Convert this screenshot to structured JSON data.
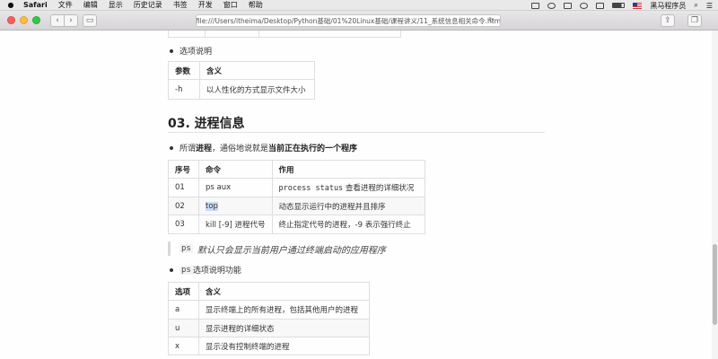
{
  "menubar": {
    "app": "Safari",
    "items": [
      "文件",
      "编辑",
      "显示",
      "历史记录",
      "书签",
      "开发",
      "窗口",
      "帮助"
    ],
    "user": "黑马程序员"
  },
  "toolbar": {
    "url": "file:///Users/itheima/Desktop/Python基础/01%20Linux基础/课程讲义/11_系统信息相关命令.htm"
  },
  "content": {
    "option_heading": "选项说明",
    "table1": {
      "headers": [
        "参数",
        "含义"
      ],
      "rows": [
        [
          "-h",
          "以人性化的方式显示文件大小"
        ]
      ]
    },
    "section_title": "03. 进程信息",
    "intro": {
      "prefix": "所谓 ",
      "term": "进程",
      "middle": "，通俗地说就是 ",
      "emph": "当前正在执行的一个程序"
    },
    "table2": {
      "headers": [
        "序号",
        "命令",
        "作用"
      ],
      "rows": [
        [
          "01",
          "ps aux",
          "process status",
          " 查看进程的详细状况"
        ],
        [
          "02",
          "top",
          "动态显示运行中的进程并且排序"
        ],
        [
          "03",
          "kill [-9] 进程代号",
          "终止指定代号的进程，-9 表示强行终止"
        ]
      ]
    },
    "quote": {
      "code": "ps",
      "text": "默认只会显示当前用户通过终端启动的应用程序"
    },
    "ps_options": {
      "code": "ps",
      "text": " 选项说明功能"
    },
    "table3": {
      "headers": [
        "选项",
        "含义"
      ],
      "rows": [
        [
          "a",
          "显示终端上的所有进程，包括其他用户的进程"
        ],
        [
          "u",
          "显示进程的详细状态"
        ],
        [
          "x",
          "显示没有控制终端的进程"
        ]
      ]
    }
  }
}
